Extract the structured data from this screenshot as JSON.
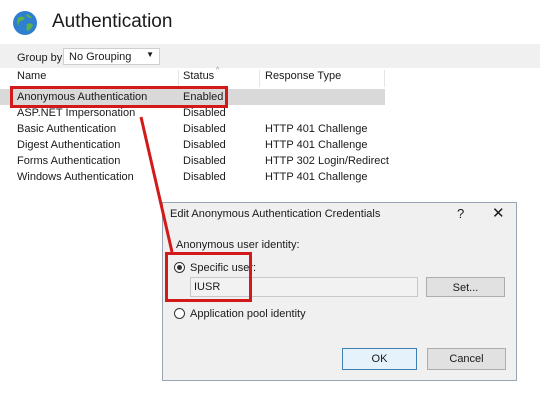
{
  "header": {
    "title": "Authentication",
    "icon": "globe-icon"
  },
  "groupby": {
    "label": "Group by:",
    "value": "No Grouping"
  },
  "columns": {
    "name": "Name",
    "status": "Status",
    "response": "Response Type"
  },
  "rows": [
    {
      "name": "Anonymous Authentication",
      "status": "Enabled",
      "response": ""
    },
    {
      "name": "ASP.NET Impersonation",
      "status": "Disabled",
      "response": ""
    },
    {
      "name": "Basic Authentication",
      "status": "Disabled",
      "response": "HTTP 401 Challenge"
    },
    {
      "name": "Digest Authentication",
      "status": "Disabled",
      "response": "HTTP 401 Challenge"
    },
    {
      "name": "Forms Authentication",
      "status": "Disabled",
      "response": "HTTP 302 Login/Redirect"
    },
    {
      "name": "Windows Authentication",
      "status": "Disabled",
      "response": "HTTP 401 Challenge"
    }
  ],
  "dialog": {
    "title": "Edit Anonymous Authentication Credentials",
    "help": "?",
    "close": "✕",
    "identity_label": "Anonymous user identity:",
    "specific_user_label": "Specific user:",
    "user_value": "IUSR",
    "set_button": "Set...",
    "app_pool_label": "Application pool identity",
    "ok_button": "OK",
    "cancel_button": "Cancel",
    "selected_option": "specific-user"
  },
  "colors": {
    "highlight": "#d21a1a",
    "selection": "#d9d9d9",
    "dialog_bg": "#f0f0f0"
  }
}
